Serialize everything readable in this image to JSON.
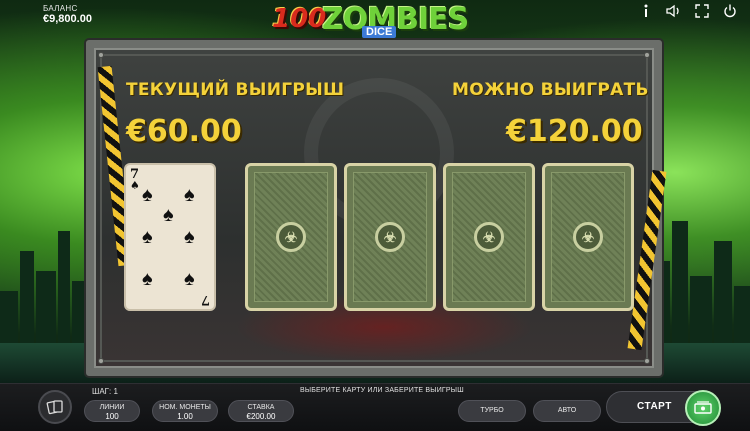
{
  "balance": {
    "label": "БАЛАНС",
    "value": "€9,800.00"
  },
  "logo": {
    "number": "100",
    "word": "ZOMBIES",
    "sub": "DICE"
  },
  "top_icons": [
    "info-icon",
    "sound-icon",
    "fullscreen-icon",
    "power-icon"
  ],
  "game": {
    "current_win_label": "ТЕКУЩИЙ ВЫИГРЫШ",
    "current_win_value": "€60.00",
    "possible_win_label": "МОЖНО ВЫИГРАТЬ",
    "possible_win_value": "€120.00",
    "revealed_card": {
      "rank": "7",
      "suit": "♠"
    },
    "hidden_cards": 4
  },
  "bottom": {
    "step": "ШАГ: 1",
    "hint": "ВЫБЕРИТЕ КАРТУ ИЛИ ЗАБЕРИТЕ ВЫИГРЫШ",
    "lines_label": "ЛИНИИ",
    "lines_value": "100",
    "coin_label": "НОМ. МОНЕТЫ",
    "coin_value": "1.00",
    "bet_label": "СТАВКА",
    "bet_value": "€200.00",
    "turbo": "ТУРБО",
    "auto": "АВТО",
    "start": "СТАРТ"
  },
  "colors": {
    "accent_yellow": "#f4d23a",
    "start_green": "#2fae47",
    "logo_red": "#d92b1d",
    "logo_green": "#6fd13a"
  }
}
